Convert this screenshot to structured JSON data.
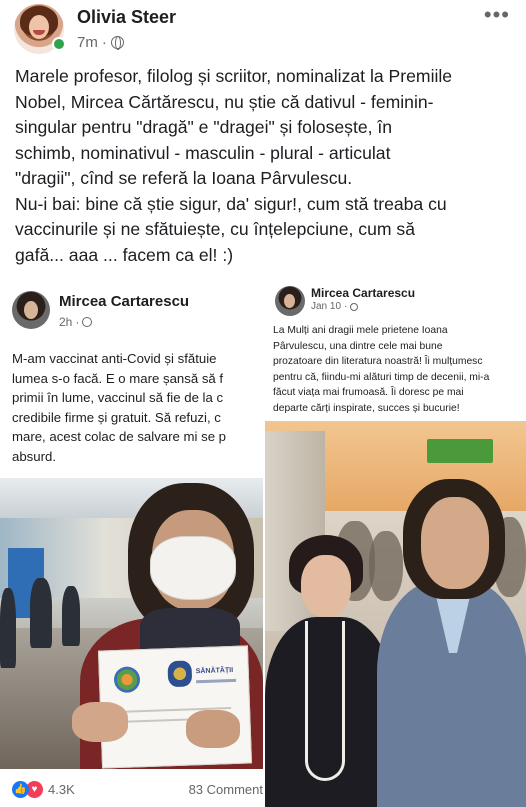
{
  "post": {
    "author": "Olivia Steer",
    "time": "7m",
    "more": "•••",
    "text_lines": [
      "Marele profesor, filolog și scriitor, nominalizat la Premiile",
      "Nobel, Mircea Cărtărescu, nu știe că dativul - feminin-",
      "singular pentru \"dragă\" e \"dragei\" și folosește, în",
      "schimb, nominativul -  masculin - plural - articulat",
      "\"dragii\", cînd se referă la Ioana Pârvulescu.",
      "Nu-i bai: bine că știe sigur, da' sigur!, cum stă treaba cu",
      "vaccinurile și ne sfătuiește, cu înțelepciune, cum să",
      "gafă... aaa ... facem ca el! :)"
    ]
  },
  "left_screenshot": {
    "author": "Mircea Cartarescu",
    "time": "2h",
    "text_lines": [
      "M-am vaccinat anti-Covid și sfătuie",
      "lumea s-o facă. E o mare șansă să f",
      "primii în lume, vaccinul să fie de la c",
      "credibile firme și gratuit. Să refuzi, c",
      "mare, acest colac de salvare mi se p",
      "absurd."
    ],
    "certificate_title": "SĂNĂTĂȚII",
    "reaction_count": "4.3K",
    "comments": "83 Comment"
  },
  "right_screenshot": {
    "author": "Mircea Cartarescu",
    "time": "Jan 10",
    "text_lines": [
      "La Mulți ani dragii mele prietene Ioana",
      "Pârvulescu, una dintre cele mai bune",
      "prozatoare din literatura noastră! Îi mulțumesc",
      "pentru că, fiindu-mi alături timp de decenii, mi-a",
      "făcut viața mai frumoasă. Îi doresc pe mai",
      "departe cărți inspirate, succes și bucurie!"
    ]
  },
  "icons": {
    "globe": "globe-icon",
    "more": "more-options-icon",
    "like": "like-reaction-icon",
    "love": "love-reaction-icon"
  },
  "colors": {
    "text": "#1c1e21",
    "meta": "#65676b",
    "online": "#31a24c",
    "like": "#1877f2",
    "love": "#f33e58"
  }
}
